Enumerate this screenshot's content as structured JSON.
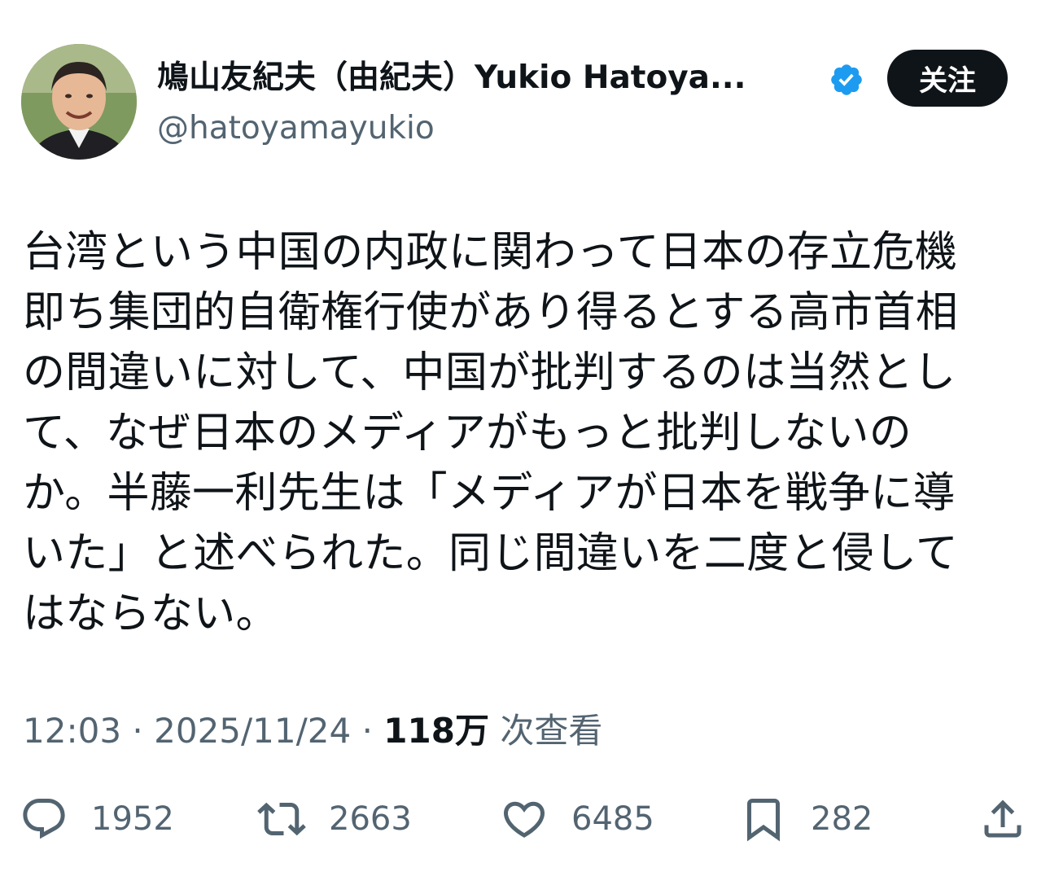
{
  "author": {
    "display_name": "鳩山友紀夫（由紀夫）Yukio Hatoya...",
    "handle": "@hatoyamayukio",
    "verified_badge_color": "#1d9bf0"
  },
  "follow_button": {
    "label": "关注"
  },
  "tweet": {
    "text": "台湾という中国の内政に関わって日本の存立危機\n即ち集団的自衛権行使があり得るとする高市首相\nの間違いに対して、中国が批判するのは当然とし\nて、なぜ日本のメディアがもっと批判しないの\nか。半藤一利先生は「メディアが日本を戦争に導\nいた」と述べられた。同じ間違いを二度と侵して\nはならない。"
  },
  "meta": {
    "time": "12:03",
    "sep1": "·",
    "date": "2025/11/24",
    "sep2": "·",
    "views_count": "118万",
    "views_label": "次查看"
  },
  "actions": {
    "reply": {
      "icon": "reply-icon",
      "count": "1952"
    },
    "retweet": {
      "icon": "retweet-icon",
      "count": "2663"
    },
    "like": {
      "icon": "heart-icon",
      "count": "6485"
    },
    "bookmark": {
      "icon": "bookmark-icon",
      "count": "282"
    },
    "share": {
      "icon": "share-icon"
    }
  },
  "colors": {
    "text_primary": "#0f1419",
    "text_secondary": "#536471",
    "accent": "#1d9bf0"
  }
}
